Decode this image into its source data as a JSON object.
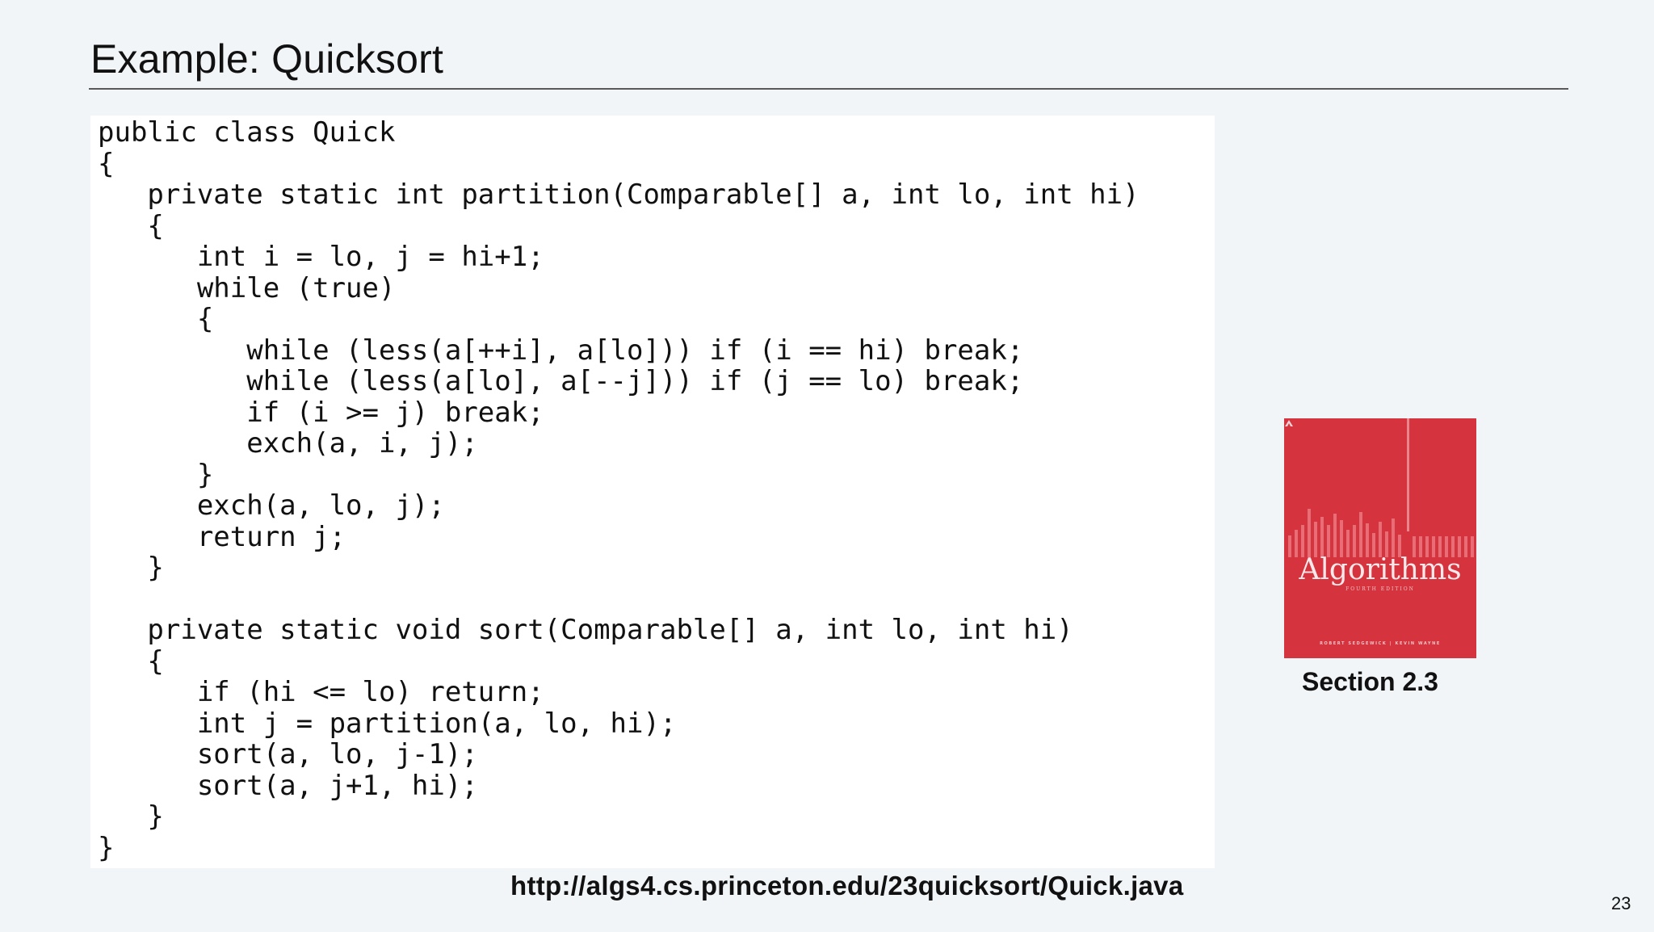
{
  "slide": {
    "title": "Example: Quicksort",
    "code_lines": [
      "public class Quick",
      "{",
      "   private static int partition(Comparable[] a, int lo, int hi)",
      "   {",
      "      int i = lo, j = hi+1;",
      "      while (true)",
      "      {",
      "         while (less(a[++i], a[lo])) if (i == hi) break;",
      "         while (less(a[lo], a[--j])) if (j == lo) break;",
      "         if (i >= j) break;",
      "         exch(a, i, j);",
      "      }",
      "      exch(a, lo, j);",
      "      return j;",
      "   }",
      "",
      "   private static void sort(Comparable[] a, int lo, int hi)",
      "   {",
      "      if (hi <= lo) return;",
      "      int j = partition(a, lo, hi);",
      "      sort(a, lo, j-1);",
      "      sort(a, j+1, hi);",
      "   }",
      "}"
    ],
    "source_url": "http://algs4.cs.princeton.edu/23quicksort/Quick.java",
    "page_number": "23"
  },
  "book": {
    "cover_title": "Algorithms",
    "edition": "FOURTH EDITION",
    "authors": "ROBERT SEDGEWICK | KEVIN WAYNE",
    "caption": "Section 2.3",
    "cover_color": "#d5333d",
    "publisher_logo_icon": "publisher-logo-icon"
  }
}
